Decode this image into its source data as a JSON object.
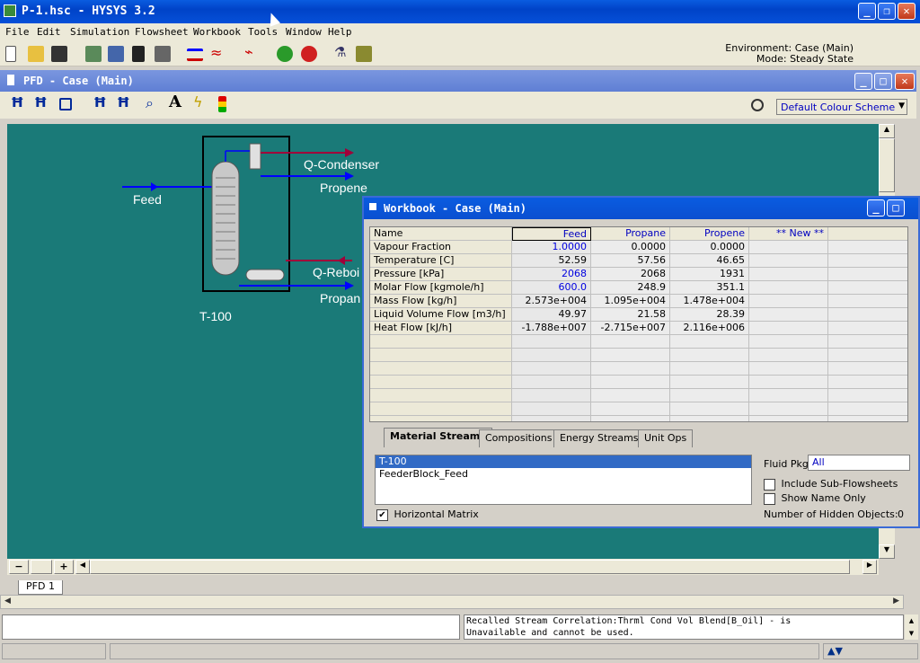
{
  "app": {
    "title": "P-1.hsc - HYSYS 3.2"
  },
  "menu": [
    "File",
    "Edit",
    "Simulation",
    "Flowsheet",
    "Workbook",
    "Tools",
    "Window",
    "Help"
  ],
  "environment": {
    "line1": "Environment: Case (Main)",
    "line2": "Mode: Steady State"
  },
  "pfd": {
    "title": "PFD - Case (Main)",
    "colour_scheme": "Default Colour Scheme",
    "tab": "PFD 1",
    "labels": {
      "feed": "Feed",
      "condenser": "Q-Condenser",
      "propene": "Propene",
      "reboiler": "Q-Reboi",
      "propane": "Propan",
      "column": "T-100"
    }
  },
  "workbook": {
    "title": "Workbook - Case (Main)",
    "columns": [
      "Name",
      "Feed",
      "Propane",
      "Propene",
      "** New **"
    ],
    "rows": [
      {
        "name": "Vapour Fraction",
        "v": [
          "1.0000",
          "0.0000",
          "0.0000",
          ""
        ]
      },
      {
        "name": "Temperature [C]",
        "v": [
          "52.59",
          "57.56",
          "46.65",
          ""
        ]
      },
      {
        "name": "Pressure [kPa]",
        "v": [
          "2068",
          "2068",
          "1931",
          ""
        ]
      },
      {
        "name": "Molar Flow [kgmole/h]",
        "v": [
          "600.0",
          "248.9",
          "351.1",
          ""
        ]
      },
      {
        "name": "Mass Flow [kg/h]",
        "v": [
          "2.573e+004",
          "1.095e+004",
          "1.478e+004",
          ""
        ]
      },
      {
        "name": "Liquid Volume Flow [m3/h]",
        "v": [
          "49.97",
          "21.58",
          "28.39",
          ""
        ]
      },
      {
        "name": "Heat Flow [kJ/h]",
        "v": [
          "-1.788e+007",
          "-2.715e+007",
          "2.116e+006",
          ""
        ]
      }
    ],
    "tabs": [
      "Material Streams",
      "Compositions",
      "Energy Streams",
      "Unit Ops"
    ],
    "list_items": [
      "T-100",
      "FeederBlock_Feed"
    ],
    "horizontal_matrix": "Horizontal Matrix",
    "fluid_pkg_label": "Fluid Pkg",
    "fluid_pkg_value": "All",
    "include_sub": "Include Sub-Flowsheets",
    "show_name": "Show Name Only",
    "hidden_objects": "Number of Hidden Objects:",
    "hidden_count": "0"
  },
  "status": {
    "message_line1": "Recalled Stream Correlation:Thrml Cond Vol Blend[B_Oil] - is",
    "message_line2": "Unavailable and cannot be used."
  },
  "colors": {
    "canvas": "#1a7a78",
    "stream": "#0000ff",
    "energy": "#a0003a",
    "titlebar": "#0a5ce0"
  }
}
